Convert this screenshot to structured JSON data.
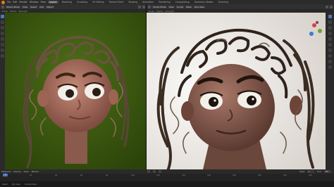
{
  "topbar": {
    "menus": [
      "File",
      "Edit",
      "Render",
      "Window",
      "Help"
    ],
    "workspaces": [
      "Layout",
      "Modeling",
      "Sculpting",
      "UV Editing",
      "Texture Paint",
      "Shading",
      "Animation",
      "Rendering",
      "Compositing",
      "Geometry Nodes",
      "Scripting"
    ],
    "active_workspace": "Layout"
  },
  "left_header": {
    "mode": "Object Mode",
    "menus": [
      "View",
      "Select",
      "Add",
      "Object"
    ]
  },
  "right_header": {
    "mode": "Sculpt Mode",
    "menus": [
      "View",
      "Sculpt",
      "Mask",
      "Face Sets"
    ]
  },
  "subheaders": {
    "left": [
      "Brush",
      "Radius",
      "Strength"
    ],
    "right": [
      "Brush",
      "Radius",
      "Strength"
    ]
  },
  "timeline": {
    "menus": [
      "Playback",
      "Keying",
      "View",
      "Marker"
    ],
    "start_label": "Start",
    "start": "1",
    "end_label": "End",
    "end": "250",
    "ticks": [
      "0",
      "20",
      "40",
      "60",
      "80",
      "100",
      "120",
      "140",
      "160",
      "180",
      "200",
      "220",
      "240"
    ],
    "current_frame": "1"
  },
  "status": {
    "left": "Select",
    "middle": "Pan View",
    "right": "Context Menu"
  },
  "colors": {
    "left_bg": "#3b5a10",
    "right_bg": "#e8e6e2",
    "accent": "#4e7ab8",
    "logo": "#e87d0d"
  }
}
